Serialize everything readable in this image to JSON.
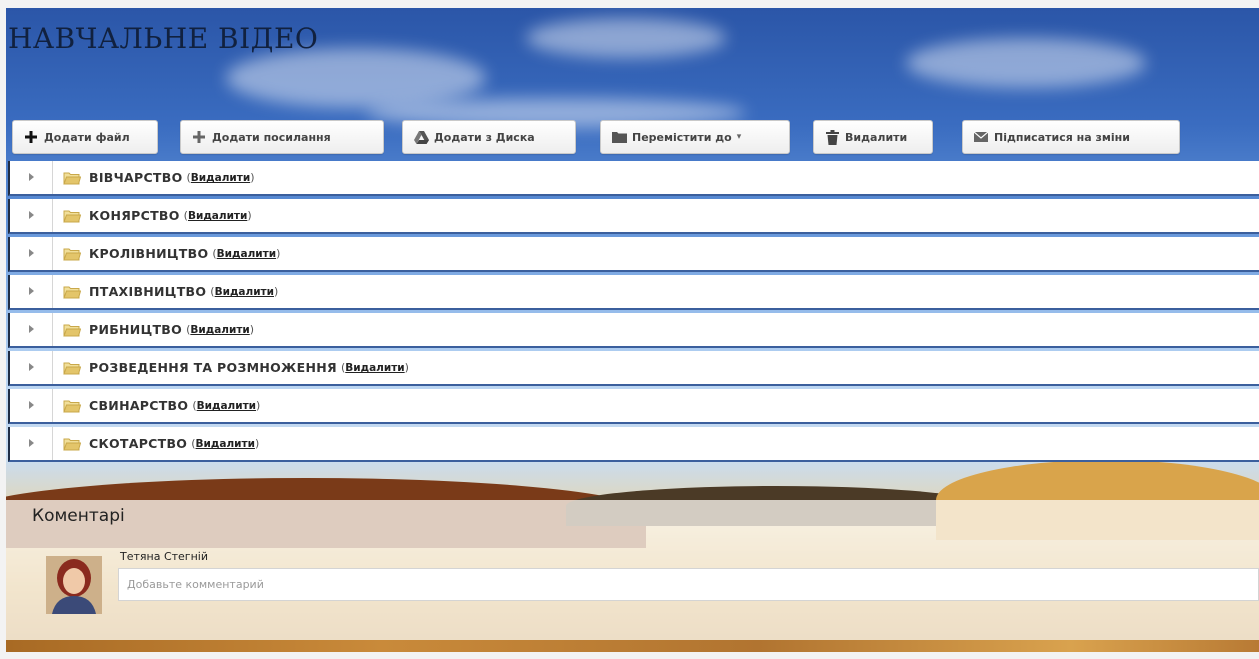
{
  "page": {
    "title": "НАВЧАЛЬНЕ ВІДЕО"
  },
  "toolbar": {
    "add_file": "Додати файл",
    "add_link": "Додати посилання",
    "add_drive": "Додати з Диска",
    "move_to": "Перемістити до",
    "delete": "Видалити",
    "subscribe": "Підписатися на зміни"
  },
  "folders": [
    {
      "name": "ВІВЧАРСТВО",
      "delete_label": "Видалити"
    },
    {
      "name": "КОНЯРСТВО",
      "delete_label": "Видалити"
    },
    {
      "name": "КРОЛІВНИЦТВО",
      "delete_label": "Видалити"
    },
    {
      "name": "ПТАХІВНИЦТВО",
      "delete_label": "Видалити"
    },
    {
      "name": "РИБНИЦТВО",
      "delete_label": "Видалити"
    },
    {
      "name": "РОЗВЕДЕННЯ ТА РОЗМНОЖЕННЯ",
      "delete_label": "Видалити"
    },
    {
      "name": "СВИНАРСТВО",
      "delete_label": "Видалити"
    },
    {
      "name": "СКОТАРСТВО",
      "delete_label": "Видалити"
    }
  ],
  "comments": {
    "heading": "Коментарі",
    "user_name": "Тетяна Стегній",
    "placeholder": "Добавьте комментарий"
  },
  "icons": {
    "add_file": "plus-icon",
    "add_link": "plus-icon",
    "add_drive": "google-drive-icon",
    "move_to": "folder-icon",
    "delete": "trash-icon",
    "subscribe": "envelope-icon",
    "row_expander": "triangle-right-icon",
    "row_folder": "folder-open-icon"
  },
  "colors": {
    "title": "#11213f",
    "row_border": "#3b5f9d",
    "folder_icon": "#e3c56a"
  }
}
